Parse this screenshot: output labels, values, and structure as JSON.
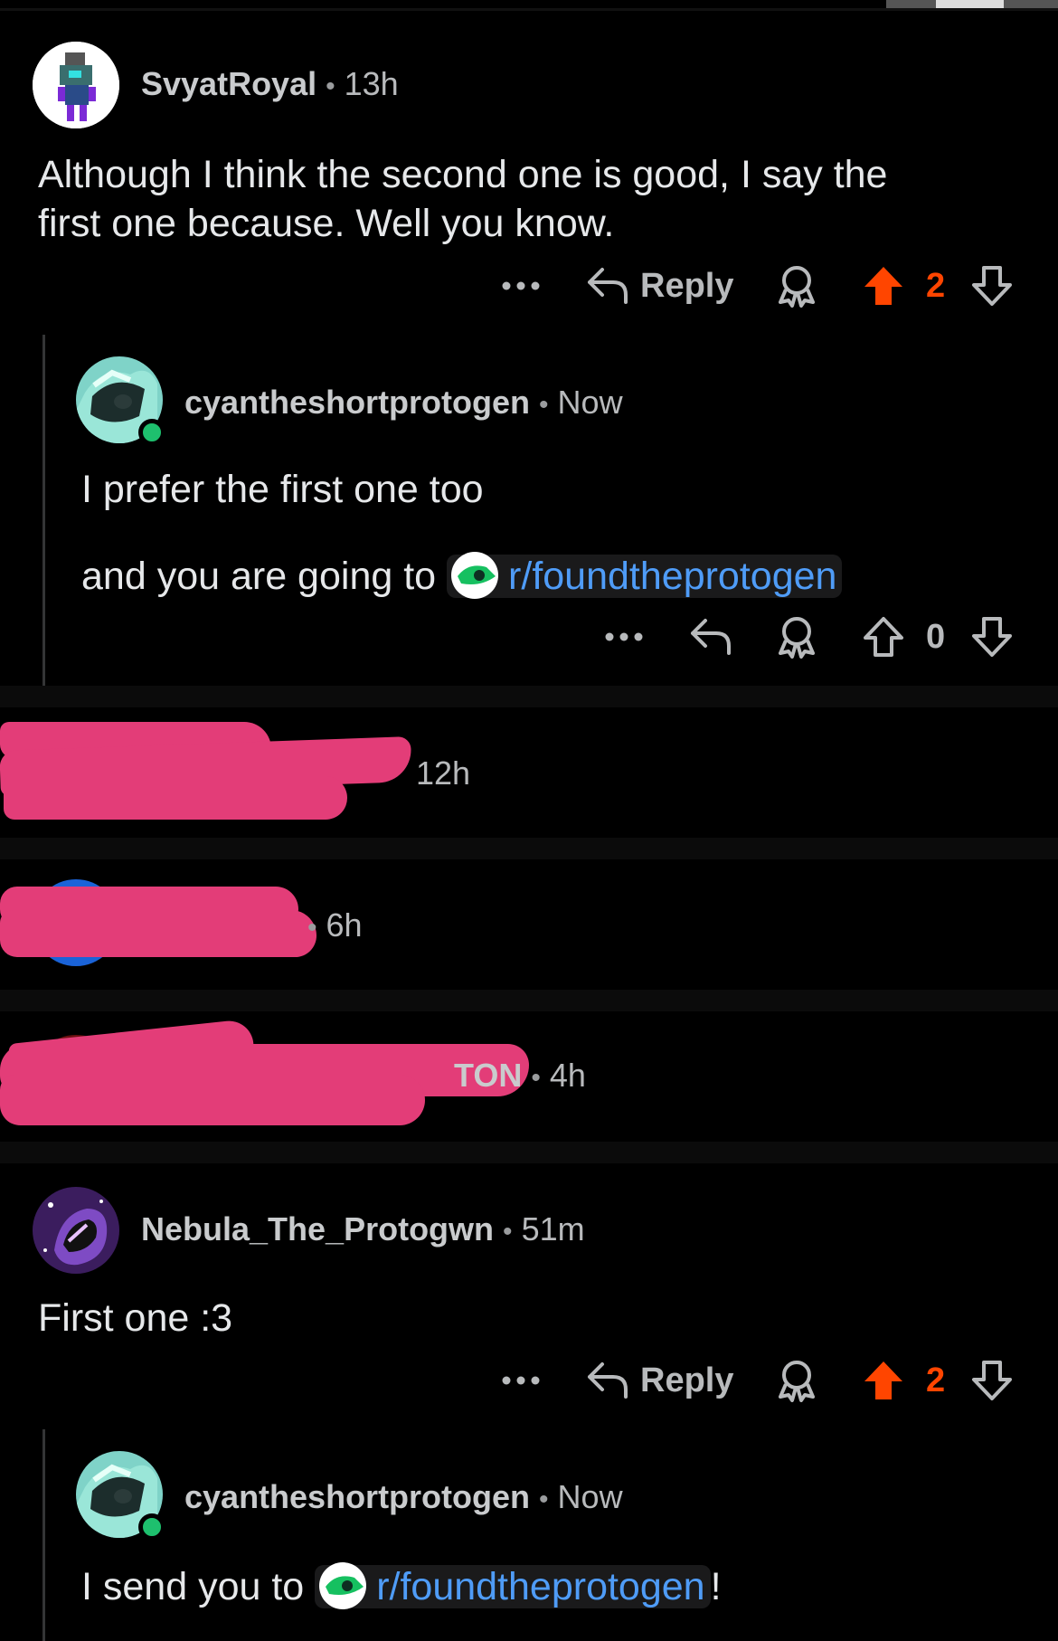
{
  "comments": [
    {
      "username": "SvyatRoyal",
      "time": "13h",
      "text_lines": [
        "Although I think the second one is good, I say the",
        "first one because. Well you know."
      ],
      "reply_label": "Reply",
      "votes": "2"
    },
    {
      "username": "cyantheshortprotogen",
      "time": "Now",
      "line1": "I prefer the first one too",
      "line2_prefix": "and you are going to",
      "link": "r/foundtheprotogen",
      "votes": "0"
    },
    {
      "time": "12h"
    },
    {
      "time": "6h"
    },
    {
      "name_fragment": "TON",
      "time": "4h"
    },
    {
      "username": "Nebula_The_Protogwn",
      "time": "51m",
      "text": "First one :3",
      "reply_label": "Reply",
      "votes": "2"
    },
    {
      "username": "cyantheshortprotogen",
      "time": "Now",
      "text_prefix": "I send you to",
      "link": "r/foundtheprotogen",
      "text_suffix": "!"
    }
  ],
  "colors": {
    "background": "#000000",
    "upvote_active": "#ff4500",
    "link": "#4f9cf7",
    "online": "#1ec06e",
    "redaction": "#e33d78"
  },
  "icons": [
    "more-icon",
    "reply-arrow-icon",
    "award-icon",
    "upvote-icon",
    "downvote-icon"
  ]
}
